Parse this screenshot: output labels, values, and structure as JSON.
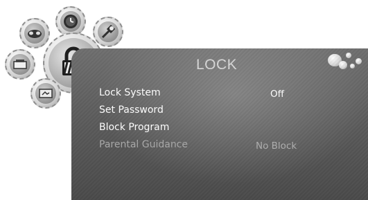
{
  "menu": {
    "title": "LOCK",
    "items": [
      {
        "label": "Lock System",
        "value": "Off",
        "enabled": true
      },
      {
        "label": "Set Password",
        "value": "",
        "enabled": true
      },
      {
        "label": "Block Program",
        "value": "",
        "enabled": true
      },
      {
        "label": "Parental Guidance",
        "value": "No Block",
        "enabled": false
      }
    ]
  },
  "icons": {
    "categories": [
      "picture-icon",
      "clock-icon",
      "settings-icon",
      "channel-icon",
      "lock-icon",
      "media-icon"
    ],
    "selected": "lock-icon",
    "decoration": "bubbles-icon"
  },
  "colors": {
    "panel": "#5f5f5f",
    "text": "#ffffff",
    "disabled_text": "#a9a9a9"
  }
}
